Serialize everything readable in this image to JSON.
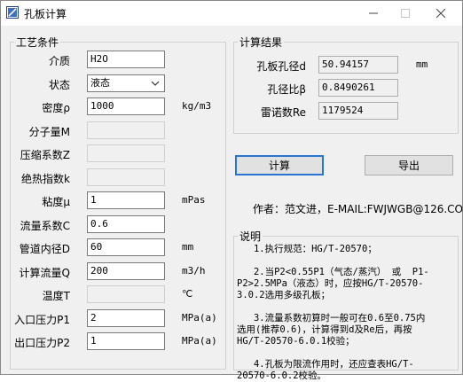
{
  "window": {
    "title": "孔板计算",
    "min_icon": "minimize-icon",
    "max_icon": "maximize-icon",
    "close_icon": "close-icon"
  },
  "left_group": {
    "title": "工艺条件",
    "rows": [
      {
        "label": "介质",
        "value": "H2O",
        "unit": "",
        "enabled": true
      },
      {
        "label": "状态",
        "value": "液态",
        "unit": "",
        "enabled": true,
        "dropdown": true
      },
      {
        "label": "密度ρ",
        "value": "1000",
        "unit": "kg/m3",
        "enabled": true
      },
      {
        "label": "分子量M",
        "value": "",
        "unit": "",
        "enabled": false
      },
      {
        "label": "压缩系数Z",
        "value": "",
        "unit": "",
        "enabled": false
      },
      {
        "label": "绝热指数k",
        "value": "",
        "unit": "",
        "enabled": false
      },
      {
        "label": "粘度μ",
        "value": "1",
        "unit": "mPas",
        "enabled": true
      },
      {
        "label": "流量系数C",
        "value": "0.6",
        "unit": "",
        "enabled": true
      },
      {
        "label": "管道内径D",
        "value": "60",
        "unit": "mm",
        "enabled": true
      },
      {
        "label": "计算流量Q",
        "value": "200",
        "unit": "m3/h",
        "enabled": true
      },
      {
        "label": "温度T",
        "value": "",
        "unit": "℃",
        "enabled": false
      },
      {
        "label": "入口压力P1",
        "value": "2",
        "unit": "MPa(a)",
        "enabled": true
      },
      {
        "label": "出口压力P2",
        "value": "1",
        "unit": "MPa(a)",
        "enabled": true
      }
    ]
  },
  "right_group": {
    "title": "计算结果",
    "rows": [
      {
        "label": "孔板孔径d",
        "value": "50.94157",
        "unit": "mm"
      },
      {
        "label": "孔径比β",
        "value": "0.8490261",
        "unit": ""
      },
      {
        "label": "雷诺数Re",
        "value": "1179524",
        "unit": ""
      }
    ]
  },
  "buttons": {
    "calc": "计算",
    "export": "导出"
  },
  "author": "作者：范文进，E-MAIL:FWJWGB@126.COM",
  "notes": {
    "title": "说明",
    "lines": [
      "   1.执行规范：HG/T-20570；",
      "",
      "   2.当P2<0.55P1（气态/蒸汽） 或  P1-",
      "P2>2.5MPa（液态）时，应按HG/T-20570-",
      "3.0.2选用多级孔板；",
      "",
      "   3.流量系数初算时一般可在0.6至0.75内",
      "选用(推荐0.6)，计算得到d及Re后，再按",
      "HG/T-20570-6.0.1校验；",
      "",
      "   4.孔板为限流作用时，还应查表HG/T-",
      "20570-6.0.2校验。"
    ]
  }
}
